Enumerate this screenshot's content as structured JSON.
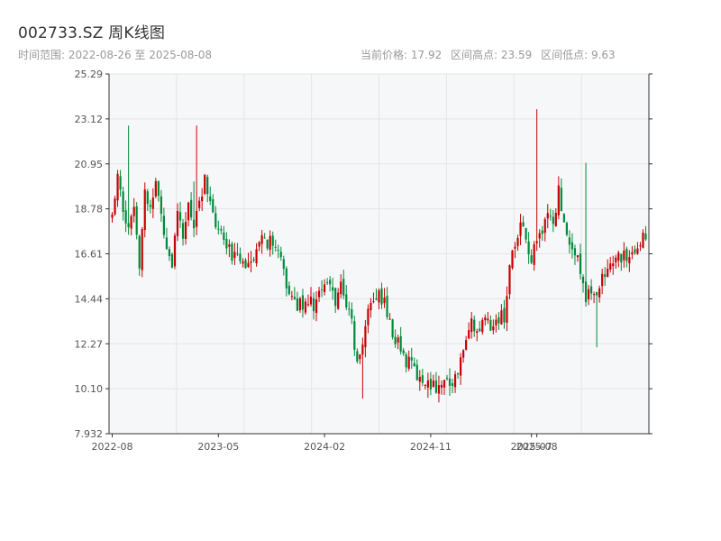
{
  "header": {
    "title": "002733.SZ 周K线图",
    "subtitle": "时间范围: 2022-08-26 至 2025-08-08",
    "current_price": "当前价格: 17.92",
    "range_high": "区间高点: 23.59",
    "range_low": "区间低点: 9.63"
  },
  "colors": {
    "up": "#c80000",
    "down": "#008a3a",
    "plot_bg": "#f6f7f9",
    "grid": "#e3e5e8",
    "axis": "#333333"
  },
  "chart_data": {
    "type": "candlestick",
    "title": "002733.SZ 周K线图",
    "ylim": [
      7.932,
      25.29
    ],
    "y_ticks": [
      "7.932",
      "10.10",
      "12.27",
      "14.44",
      "16.61",
      "18.78",
      "20.95",
      "23.12",
      "25.29"
    ],
    "x_ticks": [
      "2022-08",
      "2023-05",
      "2024-02",
      "2024-11",
      "2025-07",
      "2025-08"
    ],
    "x_tick_index": [
      0,
      39,
      78,
      117,
      154,
      156
    ],
    "grid": true,
    "series_points": [
      [
        0,
        18.3
      ],
      [
        2,
        20.8
      ],
      [
        4,
        18.9
      ],
      [
        6,
        17.6
      ],
      [
        8,
        19.2
      ],
      [
        10,
        16.3
      ],
      [
        12,
        19.5
      ],
      [
        14,
        18.8
      ],
      [
        16,
        20.3
      ],
      [
        18,
        18.4
      ],
      [
        20,
        17.2
      ],
      [
        22,
        16.0
      ],
      [
        24,
        18.3
      ],
      [
        26,
        17.4
      ],
      [
        28,
        18.9
      ],
      [
        30,
        18.1
      ],
      [
        32,
        19.3
      ],
      [
        34,
        20.1
      ],
      [
        36,
        18.8
      ],
      [
        38,
        18.0
      ],
      [
        40,
        17.4
      ],
      [
        42,
        16.9
      ],
      [
        44,
        16.5
      ],
      [
        46,
        17.0
      ],
      [
        48,
        16.2
      ],
      [
        50,
        16.4
      ],
      [
        52,
        16.0
      ],
      [
        54,
        16.9
      ],
      [
        56,
        17.4
      ],
      [
        58,
        17.1
      ],
      [
        60,
        16.7
      ],
      [
        62,
        16.2
      ],
      [
        64,
        15.2
      ],
      [
        66,
        14.4
      ],
      [
        68,
        14.1
      ],
      [
        70,
        14.3
      ],
      [
        72,
        14.5
      ],
      [
        74,
        14.1
      ],
      [
        76,
        14.6
      ],
      [
        78,
        14.9
      ],
      [
        80,
        15.1
      ],
      [
        82,
        14.4
      ],
      [
        84,
        15.1
      ],
      [
        86,
        14.3
      ],
      [
        88,
        13.1
      ],
      [
        90,
        11.2
      ],
      [
        92,
        12.3
      ],
      [
        94,
        14.1
      ],
      [
        96,
        14.4
      ],
      [
        98,
        14.6
      ],
      [
        100,
        14.3
      ],
      [
        102,
        13.1
      ],
      [
        104,
        12.6
      ],
      [
        106,
        12.1
      ],
      [
        108,
        11.5
      ],
      [
        110,
        11.1
      ],
      [
        112,
        10.8
      ],
      [
        114,
        10.4
      ],
      [
        116,
        10.5
      ],
      [
        118,
        10.3
      ],
      [
        120,
        10.3
      ],
      [
        122,
        10.3
      ],
      [
        124,
        10.5
      ],
      [
        126,
        10.6
      ],
      [
        128,
        11.5
      ],
      [
        130,
        12.8
      ],
      [
        132,
        13.2
      ],
      [
        134,
        12.8
      ],
      [
        136,
        13.2
      ],
      [
        138,
        13.4
      ],
      [
        140,
        13.0
      ],
      [
        142,
        13.6
      ],
      [
        144,
        13.5
      ],
      [
        146,
        16.1
      ],
      [
        148,
        17.0
      ],
      [
        150,
        17.8
      ],
      [
        152,
        17.3
      ],
      [
        154,
        16.4
      ],
      [
        156,
        17.0
      ],
      [
        158,
        17.9
      ],
      [
        160,
        18.6
      ],
      [
        162,
        18.1
      ],
      [
        164,
        19.6
      ],
      [
        166,
        18.4
      ],
      [
        168,
        17.3
      ],
      [
        170,
        16.4
      ],
      [
        172,
        16.0
      ],
      [
        174,
        14.6
      ],
      [
        176,
        14.5
      ],
      [
        178,
        14.9
      ],
      [
        180,
        15.3
      ],
      [
        182,
        15.5
      ],
      [
        184,
        16.2
      ],
      [
        186,
        16.7
      ],
      [
        188,
        16.4
      ],
      [
        190,
        16.6
      ],
      [
        192,
        16.3
      ],
      [
        194,
        17.3
      ],
      [
        196,
        17.7
      ]
    ],
    "spikes": {
      "6": 22.8,
      "30": 20.1,
      "31": 22.8,
      "92": 9.63,
      "122": 9.8,
      "156": 23.59,
      "174": 21.0,
      "178": 12.1
    },
    "n_candles": 197
  }
}
